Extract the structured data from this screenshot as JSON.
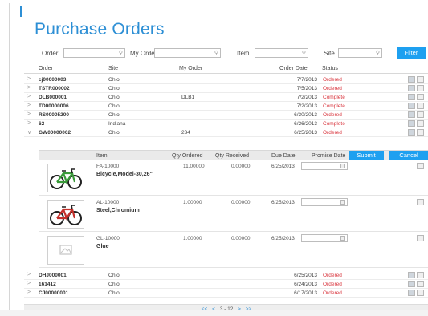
{
  "title": "Purchase Orders",
  "filters": {
    "order_label": "Order",
    "my_order_label": "My Order",
    "item_label": "Item",
    "site_label": "Site",
    "filter_button": "Filter"
  },
  "columns": {
    "order": "Order",
    "site": "Site",
    "my_order": "My Order",
    "order_date": "Order Date",
    "status": "Status"
  },
  "orders_top": [
    {
      "order": "cj00000003",
      "site": "Ohio",
      "my_order": "",
      "date": "7/7/2013",
      "status": "Ordered"
    },
    {
      "order": "TSTR000002",
      "site": "Ohio",
      "my_order": "",
      "date": "7/5/2013",
      "status": "Ordered"
    },
    {
      "order": "DLB000001",
      "site": "Ohio",
      "my_order": "DLB1",
      "date": "7/2/2013",
      "status": "Complete"
    },
    {
      "order": "TD00000006",
      "site": "Ohio",
      "my_order": "",
      "date": "7/2/2013",
      "status": "Complete"
    },
    {
      "order": "RS00005200",
      "site": "Ohio",
      "my_order": "",
      "date": "6/30/2013",
      "status": "Ordered"
    },
    {
      "order": "62",
      "site": "Indiana",
      "my_order": "",
      "date": "6/26/2013",
      "status": "Complete"
    },
    {
      "order": "GW00000002",
      "site": "Ohio",
      "my_order": "234",
      "date": "6/25/2013",
      "status": "Ordered"
    }
  ],
  "detail": {
    "item_label": "Item",
    "qty_ordered_label": "Qty Ordered",
    "qty_received_label": "Qty Received",
    "due_date_label": "Due Date",
    "promise_date_label": "Promise Date",
    "submit": "Submit",
    "cancel": "Cancel",
    "items": [
      {
        "code": "FA-10000",
        "name": "Bicycle,Model-30,26\"",
        "qty_ordered": "11.00000",
        "qty_received": "0.00000",
        "due": "6/25/2013",
        "icon": "bicycle-green"
      },
      {
        "code": "AL-10000",
        "name": "Steel,Chromium",
        "qty_ordered": "1.00000",
        "qty_received": "0.00000",
        "due": "6/25/2013",
        "icon": "bicycle-red"
      },
      {
        "code": "GL-10000",
        "name": "Glue",
        "qty_ordered": "1.00000",
        "qty_received": "0.00000",
        "due": "6/25/2013",
        "icon": "image-placeholder"
      }
    ]
  },
  "orders_bottom": [
    {
      "order": "DHJ000001",
      "site": "Ohio",
      "my_order": "",
      "date": "6/25/2013",
      "status": "Ordered"
    },
    {
      "order": "161412",
      "site": "Ohio",
      "my_order": "",
      "date": "6/24/2013",
      "status": "Ordered"
    },
    {
      "order": "CJ00000001",
      "site": "Ohio",
      "my_order": "",
      "date": "6/17/2013",
      "status": "Ordered"
    }
  ],
  "pager": {
    "first": "<<",
    "prev": "<",
    "range": "3 - 12",
    "next": ">",
    "last": ">>"
  },
  "colors": {
    "accent": "#2d8fd5",
    "button": "#1ea0f0",
    "status_red": "#d9363e"
  }
}
